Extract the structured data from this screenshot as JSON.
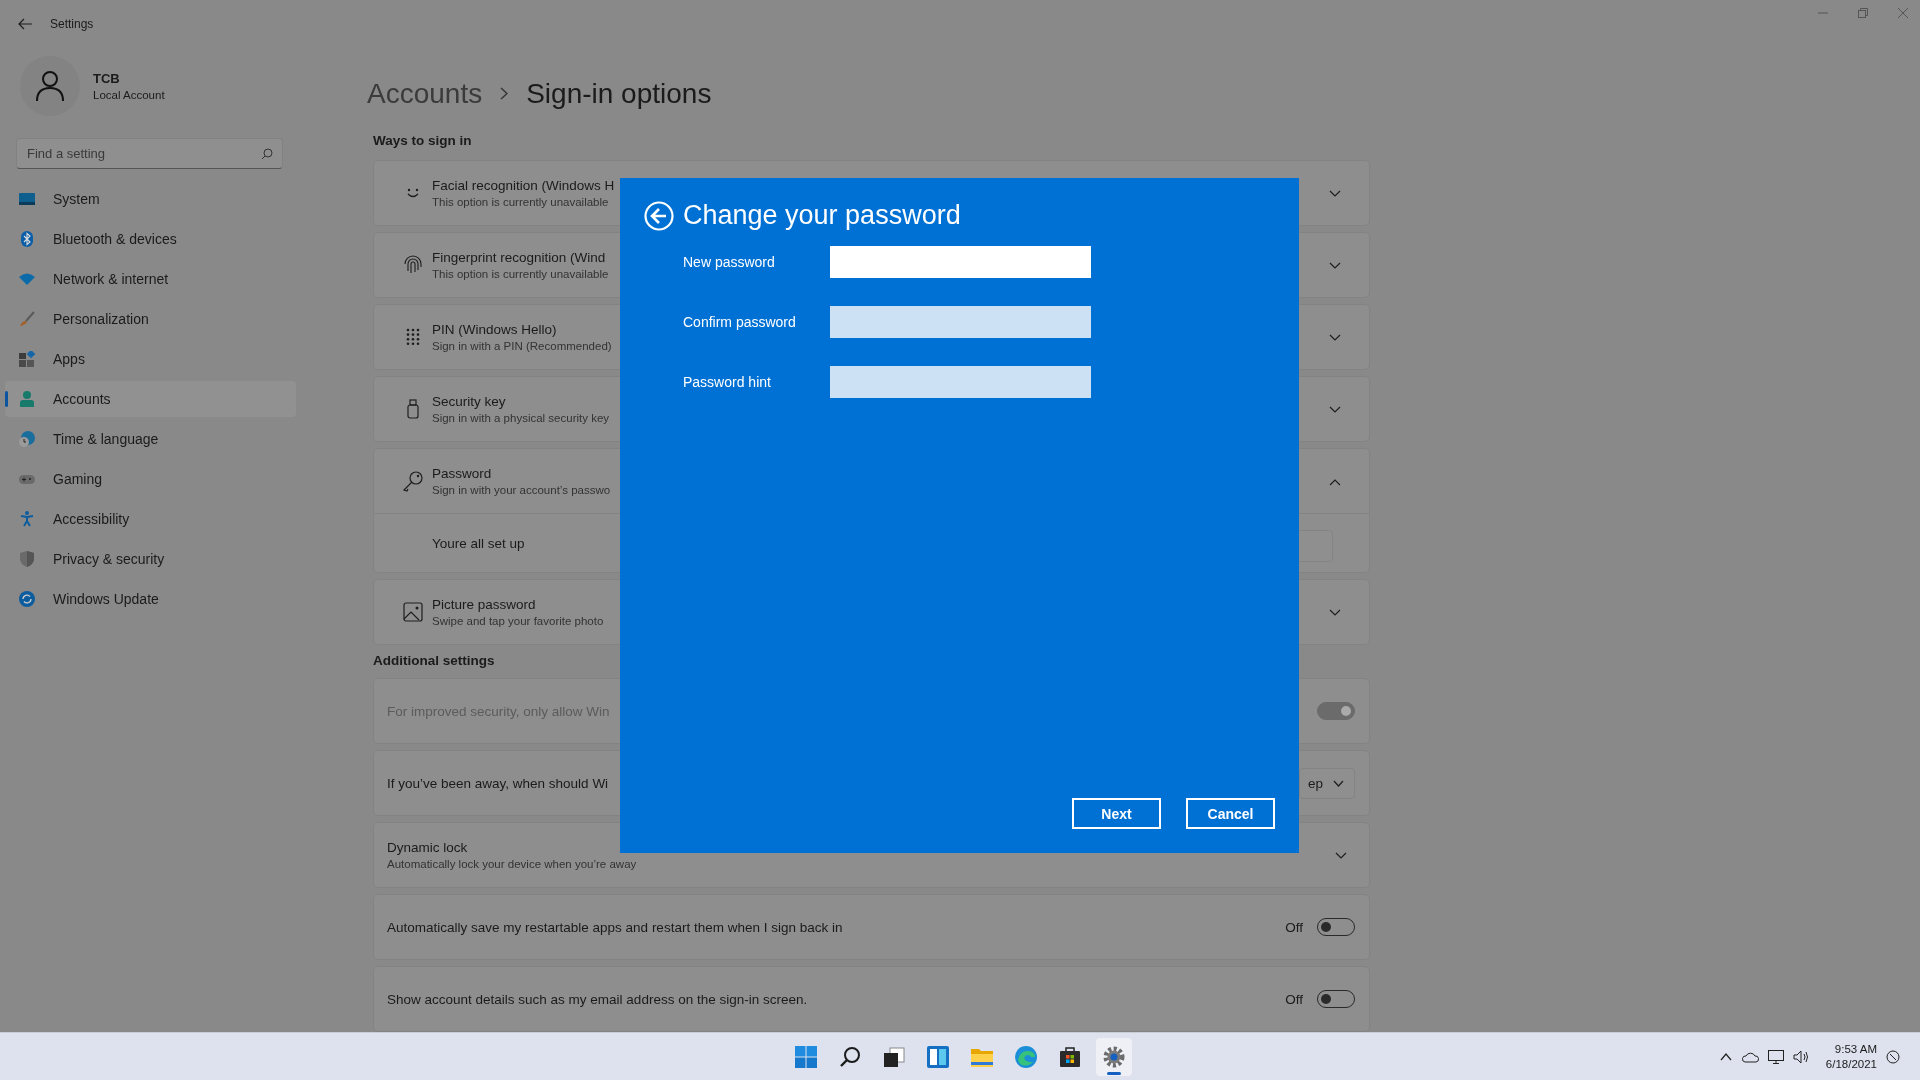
{
  "window": {
    "title": "Settings"
  },
  "account": {
    "name": "TCB",
    "type": "Local Account"
  },
  "search": {
    "placeholder": "Find a setting"
  },
  "nav": [
    {
      "kind": "system",
      "label": "System",
      "selected": false
    },
    {
      "kind": "bluetooth",
      "label": "Bluetooth & devices",
      "selected": false
    },
    {
      "kind": "network",
      "label": "Network & internet",
      "selected": false
    },
    {
      "kind": "personalization",
      "label": "Personalization",
      "selected": false
    },
    {
      "kind": "apps",
      "label": "Apps",
      "selected": false
    },
    {
      "kind": "accounts",
      "label": "Accounts",
      "selected": true
    },
    {
      "kind": "time",
      "label": "Time & language",
      "selected": false
    },
    {
      "kind": "gaming",
      "label": "Gaming",
      "selected": false
    },
    {
      "kind": "accessibility",
      "label": "Accessibility",
      "selected": false
    },
    {
      "kind": "privacy",
      "label": "Privacy & security",
      "selected": false
    },
    {
      "kind": "update",
      "label": "Windows Update",
      "selected": false
    }
  ],
  "breadcrumb": {
    "parent": "Accounts",
    "current": "Sign-in options"
  },
  "ways": {
    "heading": "Ways to sign in",
    "items": [
      {
        "kind": "face",
        "title": "Facial recognition (Windows H",
        "subtitle": "This option is currently unavailable",
        "expanded": false
      },
      {
        "kind": "fingerprint",
        "title": "Fingerprint recognition (Wind",
        "subtitle": "This option is currently unavailable",
        "expanded": false
      },
      {
        "kind": "pin",
        "title": "PIN (Windows Hello)",
        "subtitle": "Sign in with a PIN (Recommended)",
        "expanded": false
      },
      {
        "kind": "usb",
        "title": "Security key",
        "subtitle": "Sign in with a physical security key",
        "expanded": false
      },
      {
        "kind": "key",
        "title": "Password",
        "subtitle": "Sign in with your account’s passwo",
        "expanded": true,
        "detail": "Youre all set up"
      },
      {
        "kind": "picture",
        "title": "Picture password",
        "subtitle": "Swipe and tap your favorite photo",
        "expanded": false
      }
    ]
  },
  "additional": {
    "heading": "Additional settings",
    "items": [
      {
        "kind": "toggle",
        "text": "For improved security, only allow Win",
        "on": true,
        "disabled": true
      },
      {
        "kind": "dropdown",
        "text": "If you’ve been away, when should Wi",
        "value": "ep"
      },
      {
        "kind": "expander",
        "text": "Dynamic lock",
        "subtitle": "Automatically lock your device when you’re away",
        "expanded": false
      },
      {
        "kind": "toggle",
        "text": "Automatically save my restartable apps and restart them when I sign back in",
        "state_label": "Off",
        "on": false,
        "disabled": false
      },
      {
        "kind": "toggle",
        "text": "Show account details such as my email address on the sign-in screen.",
        "state_label": "Off",
        "on": false,
        "disabled": false
      }
    ]
  },
  "dialog": {
    "title": "Change your password",
    "fields": [
      {
        "label": "New password",
        "focused": true
      },
      {
        "label": "Confirm password",
        "focused": false
      },
      {
        "label": "Password hint",
        "focused": false
      }
    ],
    "buttons": [
      {
        "label": "Next"
      },
      {
        "label": "Cancel"
      }
    ]
  },
  "taskbar": {
    "apps": [
      {
        "kind": "start",
        "selected": false
      },
      {
        "kind": "search",
        "selected": false
      },
      {
        "kind": "taskview",
        "selected": false
      },
      {
        "kind": "widgets",
        "selected": false
      },
      {
        "kind": "explorer",
        "selected": false
      },
      {
        "kind": "edge",
        "selected": false
      },
      {
        "kind": "store",
        "selected": false
      },
      {
        "kind": "settings",
        "selected": true
      }
    ],
    "time": "9:53 AM",
    "date": "6/18/2021"
  }
}
